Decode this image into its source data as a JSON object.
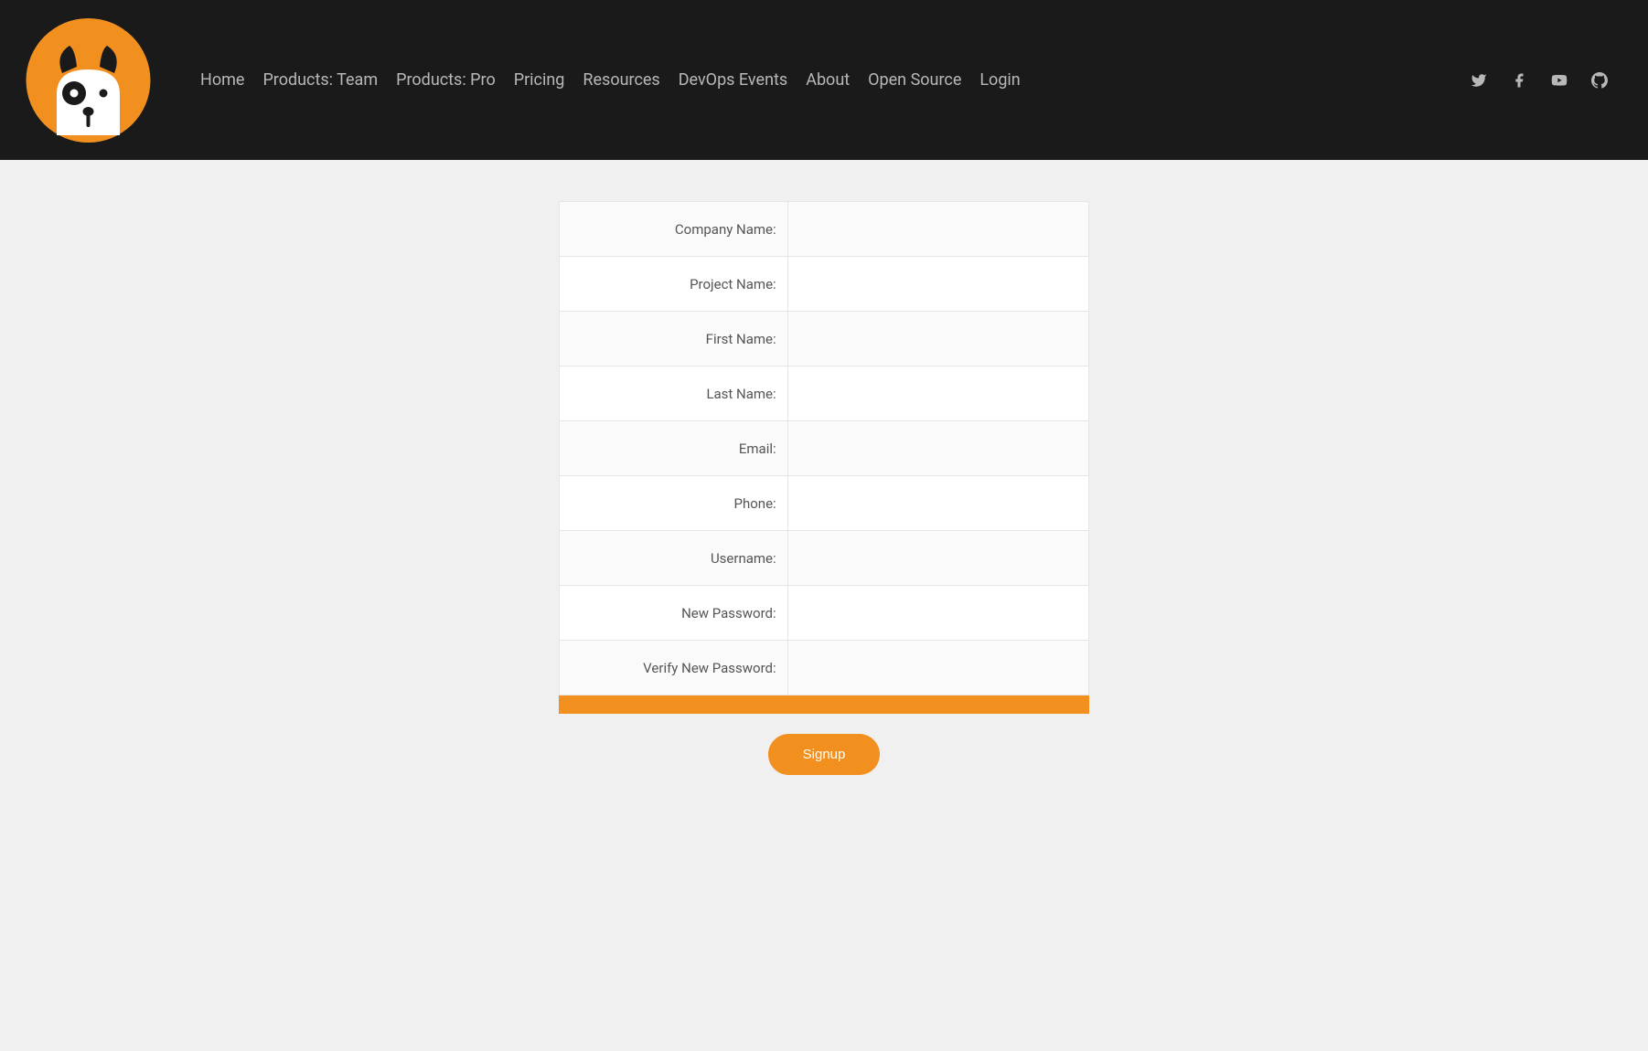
{
  "nav": {
    "items": [
      {
        "label": "Home"
      },
      {
        "label": "Products: Team"
      },
      {
        "label": "Products: Pro"
      },
      {
        "label": "Pricing"
      },
      {
        "label": "Resources"
      },
      {
        "label": "DevOps Events"
      },
      {
        "label": "About"
      },
      {
        "label": "Open Source"
      },
      {
        "label": "Login"
      }
    ]
  },
  "form": {
    "fields": [
      {
        "label": "Company Name:"
      },
      {
        "label": "Project Name:"
      },
      {
        "label": "First Name:"
      },
      {
        "label": "Last Name:"
      },
      {
        "label": "Email:"
      },
      {
        "label": "Phone:"
      },
      {
        "label": "Username:"
      },
      {
        "label": "New Password:"
      },
      {
        "label": "Verify New Password:"
      }
    ],
    "signup_label": "Signup"
  },
  "colors": {
    "accent": "#f18f1f",
    "header_bg": "#1a1a1a"
  }
}
